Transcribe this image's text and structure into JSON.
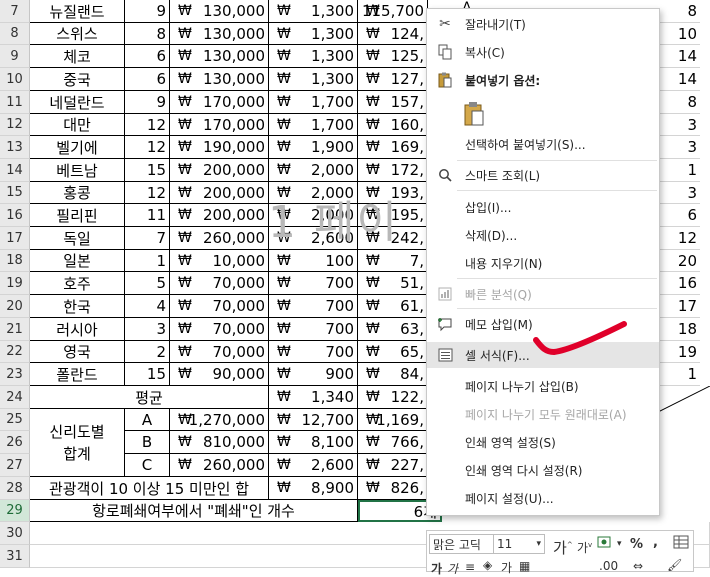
{
  "rows": [
    {
      "num": "7",
      "country": "뉴질랜드",
      "count": "9",
      "price": "130,000",
      "fee": "1,300",
      "total": "115,700",
      "right": "8"
    },
    {
      "num": "8",
      "country": "스위스",
      "count": "8",
      "price": "130,000",
      "fee": "1,300",
      "total": "124,",
      "right": "10"
    },
    {
      "num": "9",
      "country": "체코",
      "count": "6",
      "price": "130,000",
      "fee": "1,300",
      "total": "125,",
      "right": "14"
    },
    {
      "num": "10",
      "country": "중국",
      "count": "6",
      "price": "130,000",
      "fee": "1,300",
      "total": "127,",
      "right": "14"
    },
    {
      "num": "11",
      "country": "네덜란드",
      "count": "9",
      "price": "170,000",
      "fee": "1,700",
      "total": "157,",
      "right": "8"
    },
    {
      "num": "12",
      "country": "대만",
      "count": "12",
      "price": "170,000",
      "fee": "1,700",
      "total": "160,",
      "right": "3"
    },
    {
      "num": "13",
      "country": "벨기에",
      "count": "12",
      "price": "190,000",
      "fee": "1,900",
      "total": "169,",
      "right": "3"
    },
    {
      "num": "14",
      "country": "베트남",
      "count": "15",
      "price": "200,000",
      "fee": "2,000",
      "total": "172,",
      "right": "1"
    },
    {
      "num": "15",
      "country": "홍콩",
      "count": "12",
      "price": "200,000",
      "fee": "2,000",
      "total": "193,",
      "right": "3"
    },
    {
      "num": "16",
      "country": "필리핀",
      "count": "11",
      "price": "200,000",
      "fee": "2,000",
      "total": "195,",
      "right": "6"
    },
    {
      "num": "17",
      "country": "독일",
      "count": "7",
      "price": "260,000",
      "fee": "2,600",
      "total": "242,",
      "right": "12"
    },
    {
      "num": "18",
      "country": "일본",
      "count": "1",
      "price": "10,000",
      "fee": "100",
      "total": "7,",
      "right": "20"
    },
    {
      "num": "19",
      "country": "호주",
      "count": "5",
      "price": "70,000",
      "fee": "700",
      "total": "51,",
      "right": "16"
    },
    {
      "num": "20",
      "country": "한국",
      "count": "4",
      "price": "70,000",
      "fee": "700",
      "total": "61,",
      "right": "17"
    },
    {
      "num": "21",
      "country": "러시아",
      "count": "3",
      "price": "70,000",
      "fee": "700",
      "total": "63,",
      "right": "18"
    },
    {
      "num": "22",
      "country": "영국",
      "count": "2",
      "price": "70,000",
      "fee": "700",
      "total": "65,",
      "right": "19"
    },
    {
      "num": "23",
      "country": "폴란드",
      "count": "15",
      "price": "90,000",
      "fee": "900",
      "total": "84,",
      "right": "1"
    }
  ],
  "won": "₩",
  "extraRows": [
    "24",
    "25",
    "26",
    "27",
    "28",
    "29",
    "30",
    "31"
  ],
  "avg": {
    "label": "평균",
    "fee": "1,340",
    "total": "122,"
  },
  "group": {
    "label": "신리도별\n합계",
    "label1": "신리도별",
    "label2": "합계",
    "items": [
      {
        "key": "A",
        "price": "1,270,000",
        "fee": "12,700",
        "total": "1,169,"
      },
      {
        "key": "B",
        "price": "810,000",
        "fee": "8,100",
        "total": "766,"
      },
      {
        "key": "C",
        "price": "260,000",
        "fee": "2,600",
        "total": "227,"
      }
    ]
  },
  "row28": {
    "label": "관광객이 10 이상 15 미만인 합",
    "fee": "8,900",
    "total": "826,"
  },
  "row29": {
    "label": "항로폐쇄여부에서 \"폐쇄\"인 개수",
    "value": "6개"
  },
  "partial_top_total": "115,7",
  "col_partial": "A",
  "watermark": "1 페이",
  "menu": {
    "cut": "잘라내기(T)",
    "copy": "복사(C)",
    "paste_options": "붙여넣기 옵션:",
    "paste_special": "선택하여 붙여넣기(S)...",
    "smart_lookup": "스마트 조회(L)",
    "insert": "삽입(I)...",
    "delete": "삭제(D)...",
    "clear": "내용 지우기(N)",
    "quick_analysis": "빠른 분석(Q)",
    "insert_comment": "메모 삽입(M)",
    "format_cells": "셀 서식(F)...",
    "insert_page_break": "페이지 나누기 삽입(B)",
    "reset_page_breaks": "페이지 나누기 모두 원래대로(A)",
    "set_print_area": "인쇄 영역 설정(S)",
    "reset_print_area": "인쇄 영역 다시 설정(R)",
    "page_setup": "페이지 설정(U)..."
  },
  "mini": {
    "font": "맑은 고딕",
    "size": "11",
    "percent": "%",
    "comma": ","
  },
  "colors": {
    "accent": "#217346",
    "annotation": "#e0002a",
    "highlight": "#e5e5e5"
  }
}
